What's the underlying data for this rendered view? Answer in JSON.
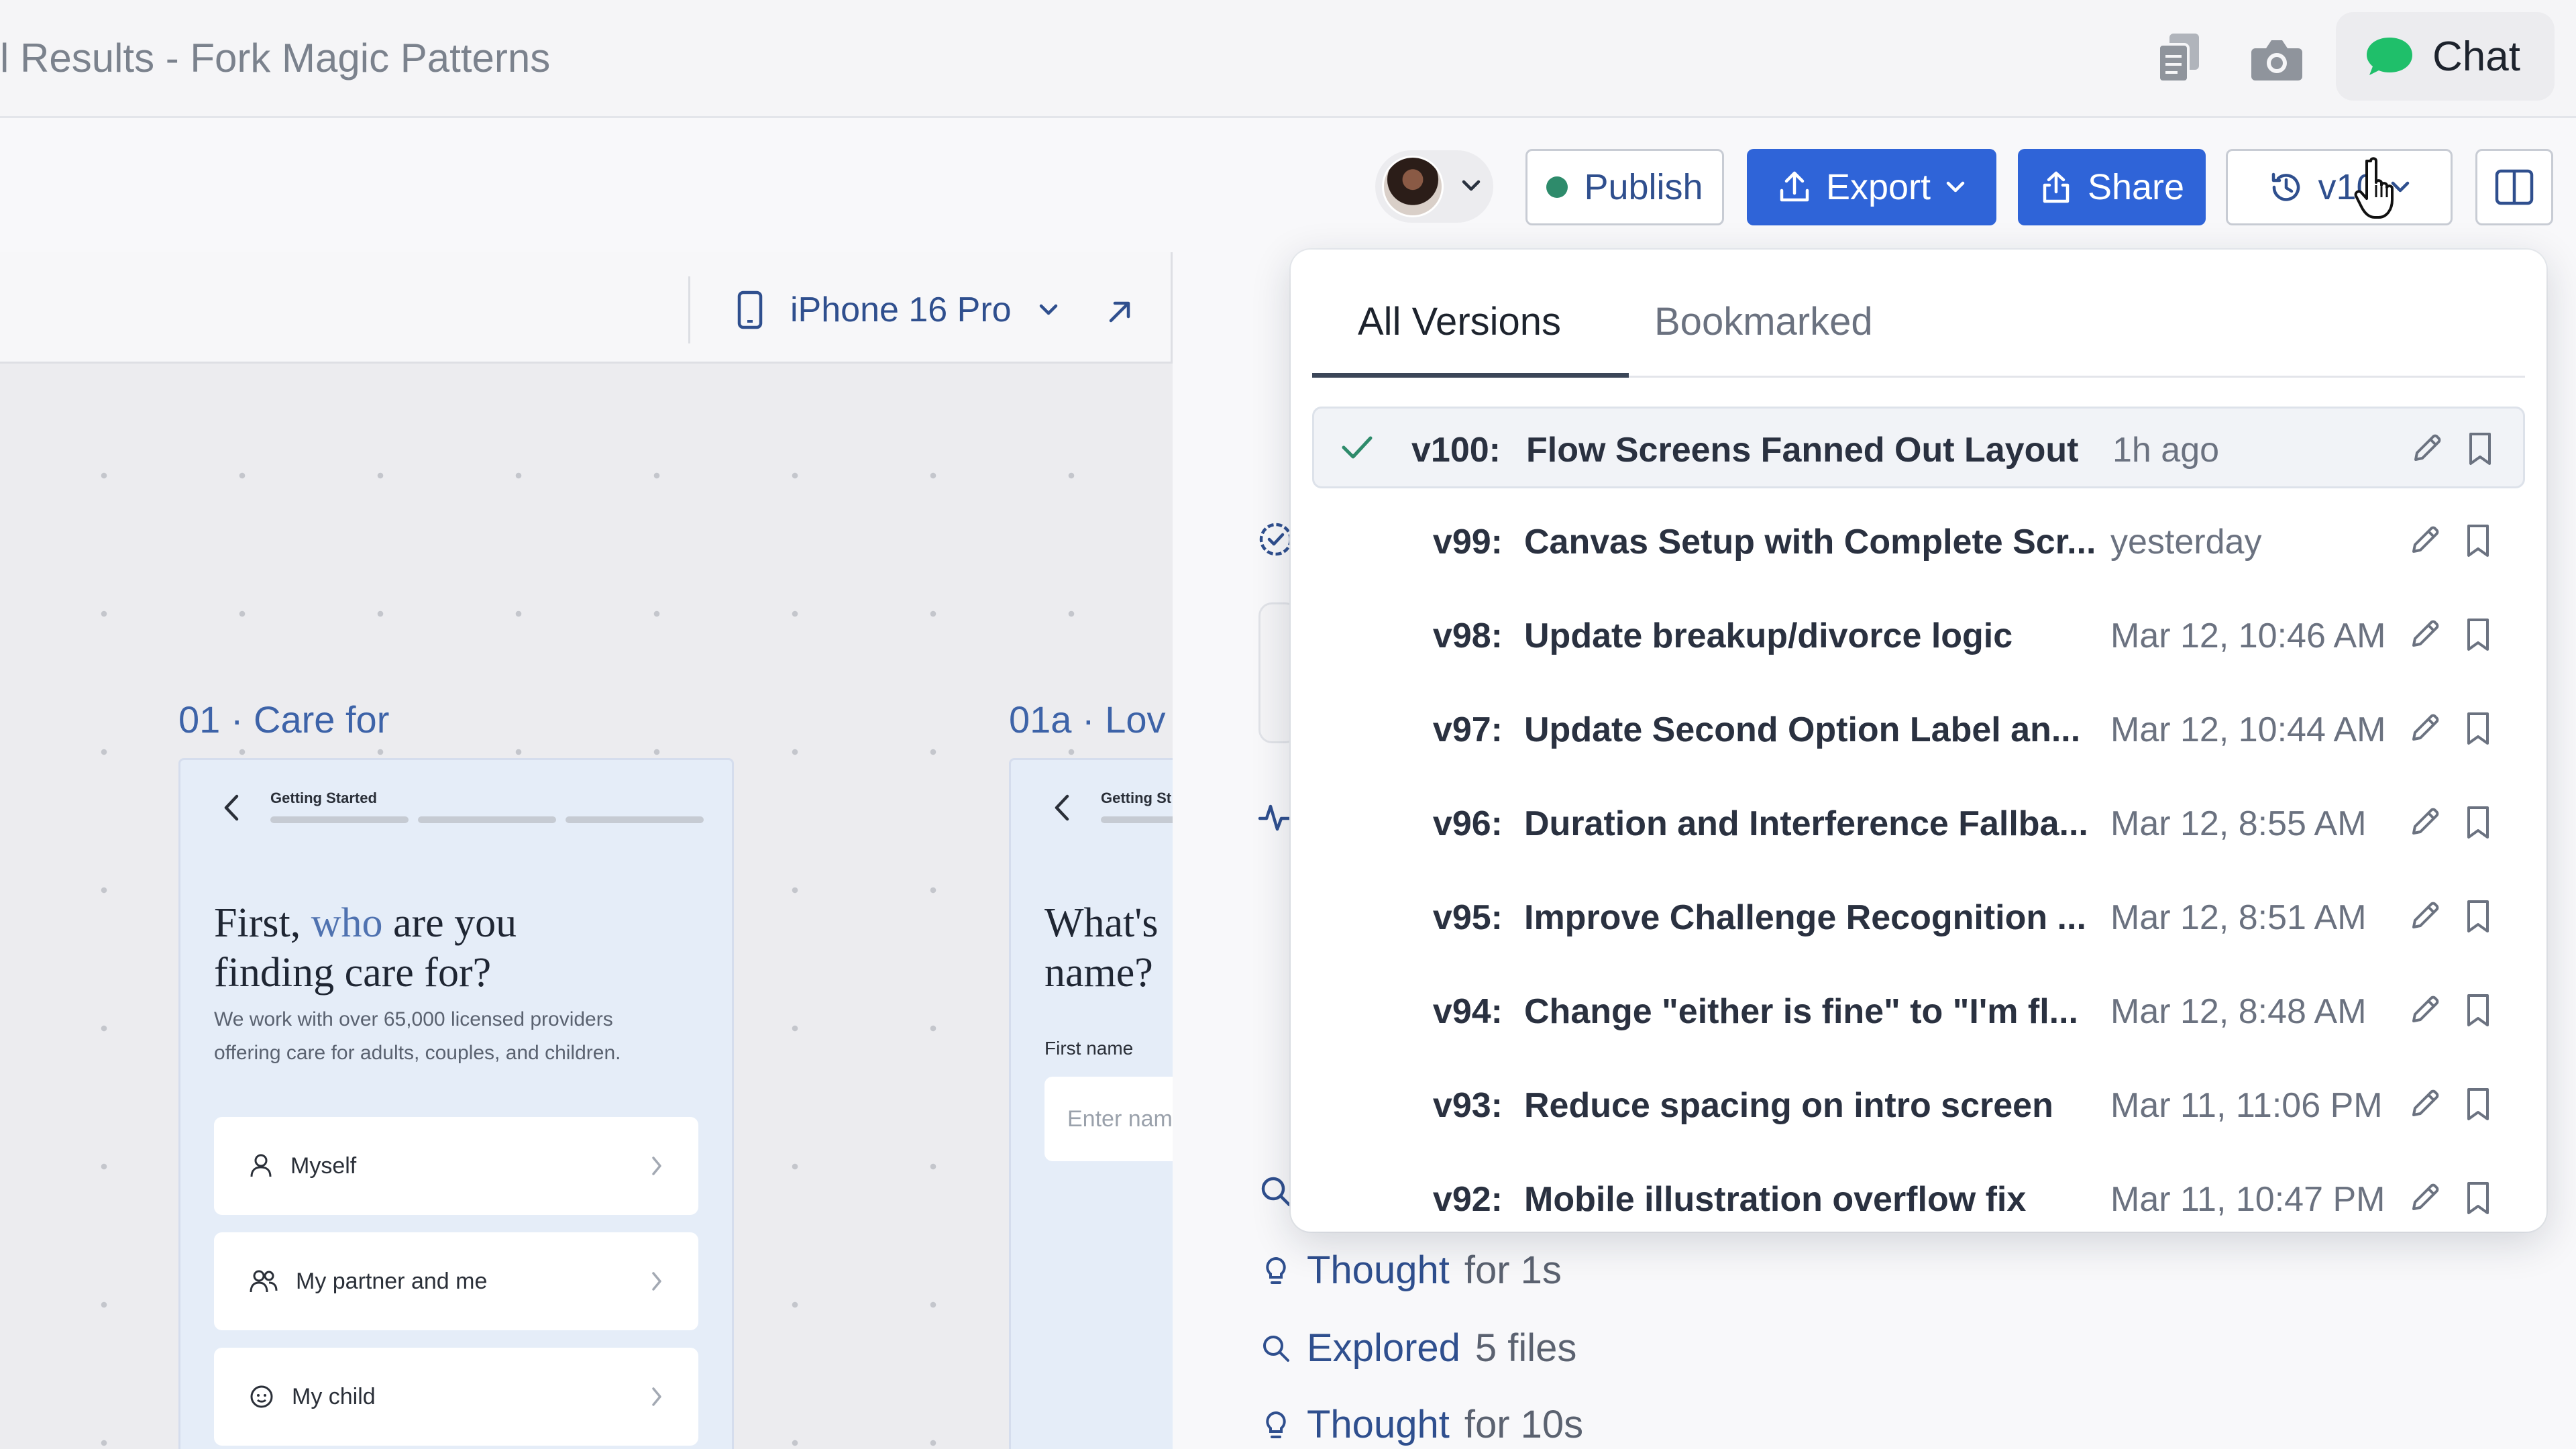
{
  "window": {
    "title": "l Results - Fork Magic Patterns"
  },
  "titlebar": {
    "chat_label": "Chat",
    "copy_icon": "copy-icon",
    "camera_icon": "camera-icon"
  },
  "toolbar": {
    "publish_label": "Publish",
    "export_label": "Export",
    "share_label": "Share",
    "version_label": "v10",
    "colors": {
      "primary": "#2f64d8",
      "publish_dot": "#2e8b6b",
      "chat_bubble": "#1fbf6a"
    }
  },
  "canvas": {
    "device_label": "iPhone 16 Pro",
    "frames": [
      {
        "title": "01 · Care for",
        "step": "Getting Started",
        "heading_line1_pre": "First, ",
        "heading_highlight": "who",
        "heading_line1_post": " are you",
        "heading_line2": "finding care for?",
        "subtitle": "We work with over 65,000 licensed providers offering care for adults, couples, and children.",
        "options": [
          "Myself",
          "My partner and me",
          "My child"
        ]
      },
      {
        "title": "01a · Lov",
        "step": "Getting St",
        "heading_line1": "What's",
        "heading_line2": "name?",
        "field_label": "First name",
        "field_placeholder": "Enter nam"
      }
    ]
  },
  "versions": {
    "tabs": [
      "All Versions",
      "Bookmarked"
    ],
    "active_tab": "All Versions",
    "items": [
      {
        "version": "v100:",
        "title": "Flow Screens Fanned Out Layout",
        "time": "1h ago",
        "selected": true
      },
      {
        "version": "v99:",
        "title": "Canvas Setup with Complete Scr...",
        "time": "yesterday"
      },
      {
        "version": "v98:",
        "title": "Update breakup/divorce logic",
        "time": "Mar 12, 10:46 AM"
      },
      {
        "version": "v97:",
        "title": "Update Second Option Label an...",
        "time": "Mar 12, 10:44 AM"
      },
      {
        "version": "v96:",
        "title": "Duration and Interference Fallba...",
        "time": "Mar 12, 8:55 AM"
      },
      {
        "version": "v95:",
        "title": "Improve Challenge Recognition ...",
        "time": "Mar 12, 8:51 AM"
      },
      {
        "version": "v94:",
        "title": "Change \"either is fine\" to \"I'm fl...",
        "time": "Mar 12, 8:48 AM"
      },
      {
        "version": "v93:",
        "title": "Reduce spacing on intro screen",
        "time": "Mar 11, 11:06 PM"
      },
      {
        "version": "v92:",
        "title": "Mobile illustration overflow fix",
        "time": "Mar 11, 10:47 PM"
      }
    ]
  },
  "chat_log": [
    {
      "kind": "thought",
      "keyword": "Thought",
      "rest": "for 1s",
      "icon": "lightbulb-icon"
    },
    {
      "kind": "explored",
      "keyword": "Explored",
      "rest": "5 files",
      "icon": "search-icon"
    },
    {
      "kind": "thought",
      "keyword": "Thought",
      "rest": "for 10s",
      "icon": "lightbulb-icon"
    }
  ]
}
